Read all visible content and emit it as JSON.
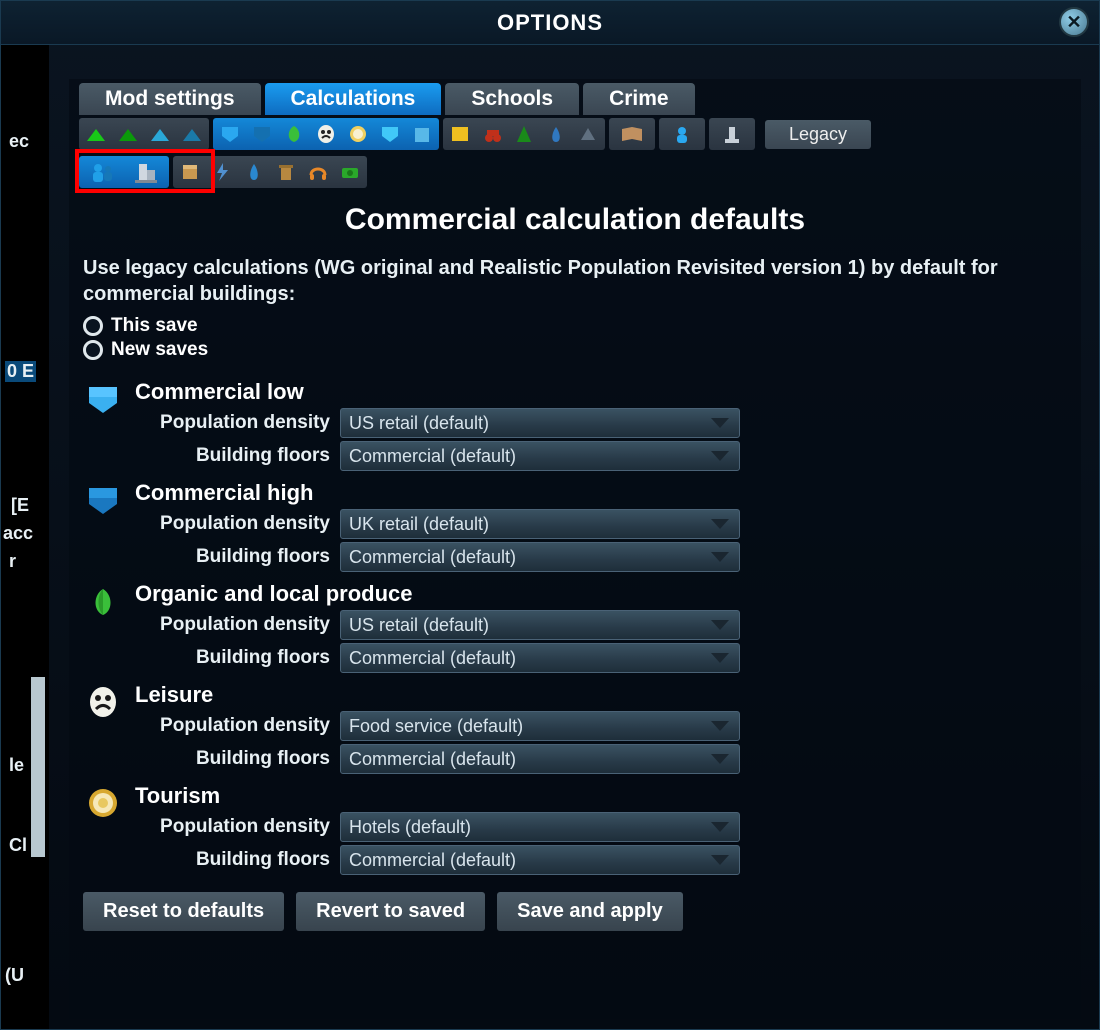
{
  "window": {
    "title": "OPTIONS"
  },
  "tabs": {
    "items": [
      {
        "label": "Mod settings",
        "active": false
      },
      {
        "label": "Calculations",
        "active": true
      },
      {
        "label": "Schools",
        "active": false
      },
      {
        "label": "Crime",
        "active": false
      }
    ]
  },
  "iconbar_top": {
    "groups": [
      {
        "name": "residential",
        "active": false,
        "icons": [
          "res-low",
          "res-high",
          "res-eco-low",
          "res-eco-high"
        ]
      },
      {
        "name": "commercial",
        "active": true,
        "icons": [
          "com-low",
          "com-high",
          "organic",
          "leisure",
          "tourism",
          "com-eco",
          "com-eco2"
        ]
      },
      {
        "name": "office",
        "active": false,
        "icons": [
          "office",
          "farming",
          "forestry",
          "oil",
          "ore"
        ]
      },
      {
        "name": "education",
        "active": false,
        "icons": [
          "education"
        ]
      },
      {
        "name": "citizen",
        "active": false,
        "icons": [
          "citizen"
        ]
      },
      {
        "name": "unique",
        "active": false,
        "icons": [
          "monument"
        ]
      }
    ],
    "legacy_label": "Legacy"
  },
  "iconbar_sub": {
    "groups": [
      {
        "name": "pop-subtab",
        "active": true,
        "icons": [
          "people",
          "building"
        ]
      },
      {
        "name": "goods-subtab",
        "active": false,
        "icons": [
          "goods",
          "power",
          "water",
          "garbage",
          "noise",
          "income"
        ]
      }
    ]
  },
  "panel": {
    "title": "Commercial calculation defaults",
    "description": "Use legacy calculations (WG original and Realistic Population Revisited version 1) by default for commercial buildings:",
    "radios": [
      {
        "label": "This save"
      },
      {
        "label": "New saves"
      }
    ]
  },
  "categories": [
    {
      "name": "commercial-low",
      "icon": "com-low",
      "title": "Commercial low",
      "rows": [
        {
          "label": "Population density",
          "value": "US retail (default)"
        },
        {
          "label": "Building floors",
          "value": "Commercial (default)"
        }
      ]
    },
    {
      "name": "commercial-high",
      "icon": "com-high",
      "title": "Commercial high",
      "rows": [
        {
          "label": "Population density",
          "value": "UK retail (default)"
        },
        {
          "label": "Building floors",
          "value": "Commercial (default)"
        }
      ]
    },
    {
      "name": "organic-produce",
      "icon": "organic",
      "title": "Organic and local produce",
      "rows": [
        {
          "label": "Population density",
          "value": "US retail (default)"
        },
        {
          "label": "Building floors",
          "value": "Commercial (default)"
        }
      ]
    },
    {
      "name": "leisure",
      "icon": "leisure",
      "title": "Leisure",
      "rows": [
        {
          "label": "Population density",
          "value": "Food service (default)"
        },
        {
          "label": "Building floors",
          "value": "Commercial (default)"
        }
      ]
    },
    {
      "name": "tourism",
      "icon": "tourism",
      "title": "Tourism",
      "rows": [
        {
          "label": "Population density",
          "value": "Hotels (default)"
        },
        {
          "label": "Building floors",
          "value": "Commercial (default)"
        }
      ]
    }
  ],
  "footer": {
    "reset": "Reset to defaults",
    "revert": "Revert to saved",
    "save": "Save and apply"
  },
  "sidebar_fragments": [
    "ec",
    "0 E",
    "[E",
    "acc",
    "r",
    "le",
    "Cl",
    "(U"
  ]
}
